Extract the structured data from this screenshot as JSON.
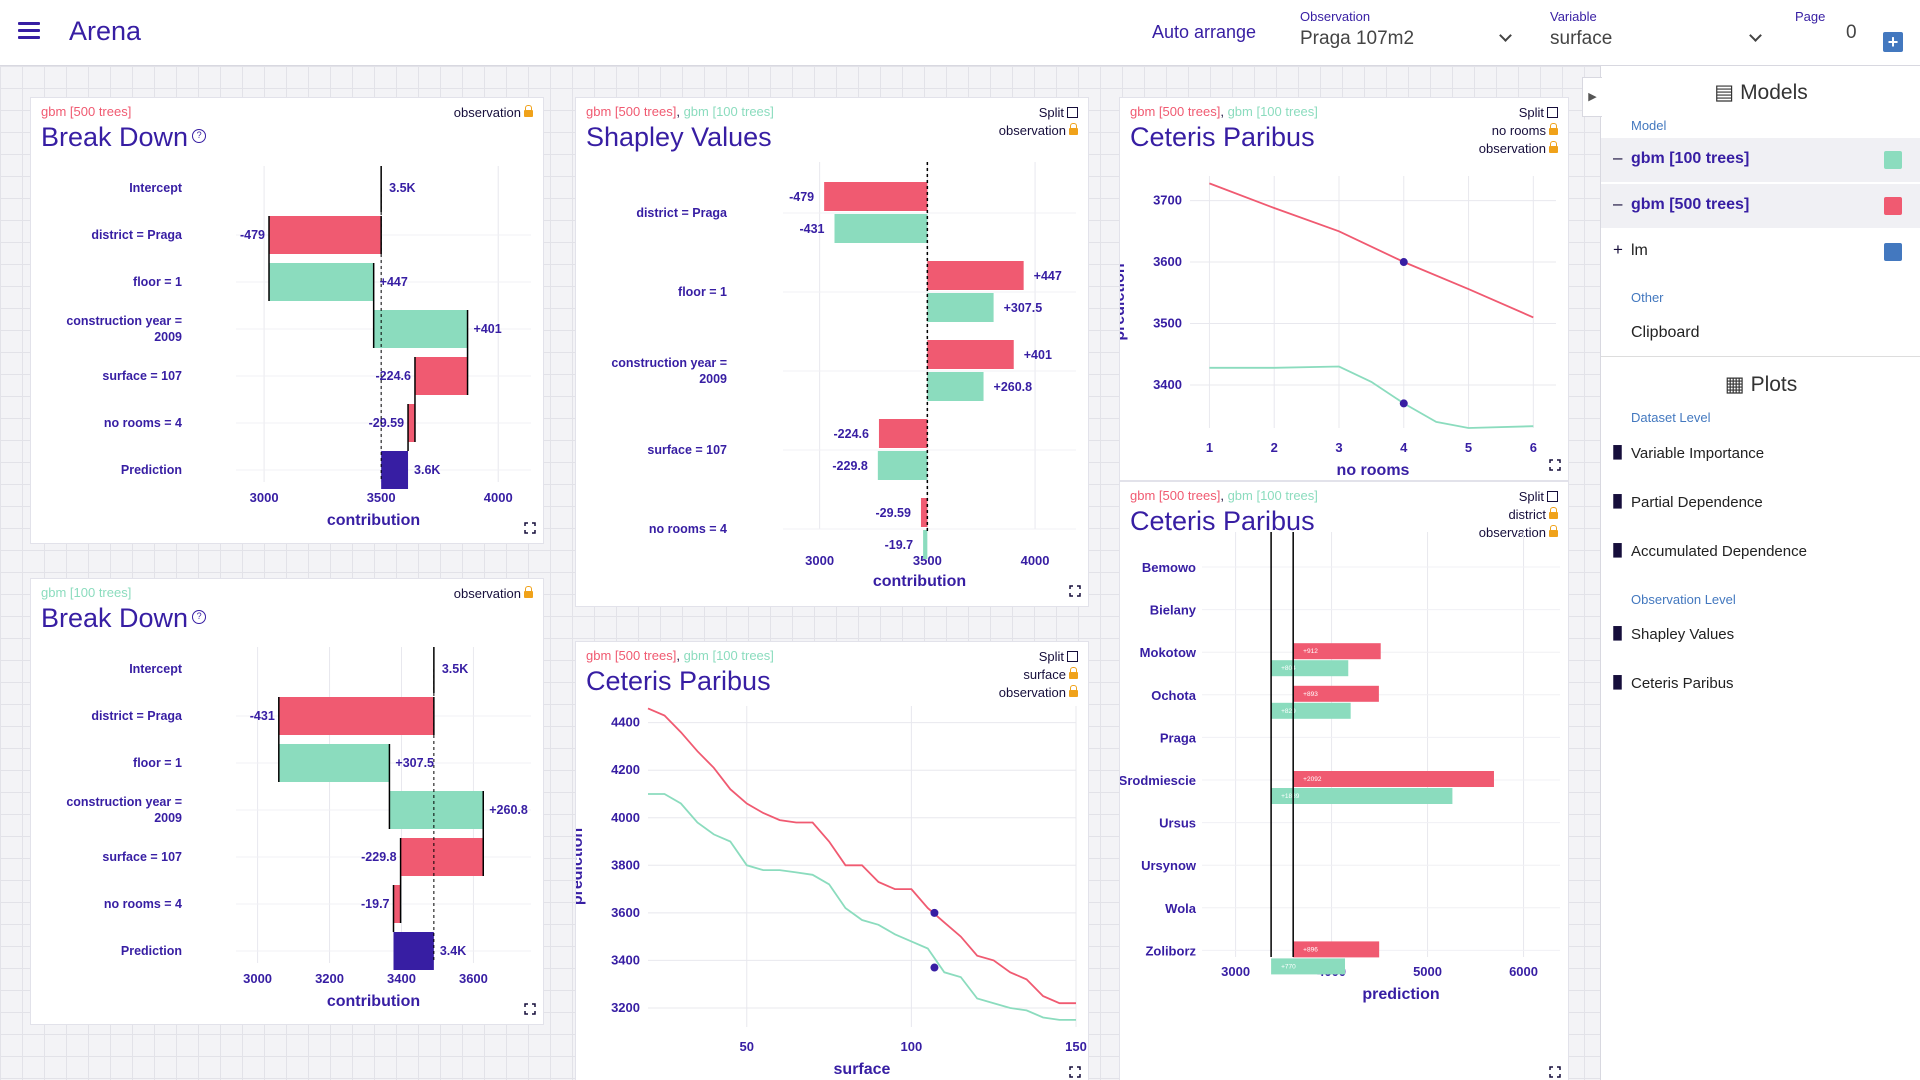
{
  "header": {
    "title": "Arena",
    "auto_arrange": "Auto arrange",
    "observation_label": "Observation",
    "observation_value": "Praga 107m2",
    "variable_label": "Variable",
    "variable_value": "surface",
    "page_label": "Page",
    "page_value": "0",
    "add_page": "+"
  },
  "colors": {
    "gbm500": "#f05a71",
    "gbm100": "#8bdcbe",
    "lm": "#4378bf",
    "accent": "#371ea3",
    "prediction": "#371ea3"
  },
  "panels": {
    "bd1": {
      "model": "gbm [500 trees]",
      "title": "Break Down",
      "right": [
        "observation"
      ]
    },
    "bd2": {
      "model": "gbm [100 trees]",
      "title": "Break Down",
      "right": [
        "observation"
      ]
    },
    "sv": {
      "model1": "gbm [500 trees]",
      "sep": ", ",
      "model2": "gbm [100 trees]",
      "title": "Shapley Values",
      "right": [
        "Split",
        "observation"
      ]
    },
    "cp1": {
      "model1": "gbm [500 trees]",
      "sep": ", ",
      "model2": "gbm [100 trees]",
      "title": "Ceteris Paribus",
      "right": [
        "Split",
        "no rooms",
        "observation"
      ]
    },
    "cp2": {
      "model1": "gbm [500 trees]",
      "sep": ", ",
      "model2": "gbm [100 trees]",
      "title": "Ceteris Paribus",
      "right": [
        "Split",
        "surface",
        "observation"
      ]
    },
    "cp3": {
      "model1": "gbm [500 trees]",
      "sep": ", ",
      "model2": "gbm [100 trees]",
      "title": "Ceteris Paribus",
      "right": [
        "Split",
        "district",
        "observation"
      ]
    }
  },
  "sidebar": {
    "models_title": "Models",
    "model_label": "Model",
    "models": [
      {
        "sign": "–",
        "name": "gbm [100 trees]",
        "color": "#8bdcbe",
        "active": true
      },
      {
        "sign": "–",
        "name": "gbm [500 trees]",
        "color": "#f05a71",
        "active": true
      },
      {
        "sign": "+",
        "name": "lm",
        "color": "#4378bf",
        "active": false
      }
    ],
    "other_label": "Other",
    "clipboard": "Clipboard",
    "plots_title": "Plots",
    "dataset_level": "Dataset Level",
    "dataset_plots": [
      "Variable Importance",
      "Partial Dependence",
      "Accumulated Dependence"
    ],
    "observation_level": "Observation Level",
    "observation_plots": [
      "Shapley Values",
      "Ceteris Paribus"
    ]
  },
  "chart_data": [
    {
      "id": "bd1",
      "type": "bar",
      "subtype": "waterfall",
      "model": "gbm [500 trees]",
      "title": "Break Down",
      "xlabel": "contribution",
      "xlim": [
        2880,
        4140
      ],
      "xticks": [
        3000,
        3500,
        4000
      ],
      "grid": true,
      "rows": [
        {
          "label": "Intercept",
          "start": 3500,
          "end": 3500,
          "text": "3.5K",
          "kind": "intercept"
        },
        {
          "label": "district = Praga",
          "start": 3500,
          "end": 3021,
          "text": "-479",
          "kind": "neg"
        },
        {
          "label": "floor = 1",
          "start": 3021,
          "end": 3468,
          "text": "+447",
          "kind": "pos"
        },
        {
          "label": "construction year = 2009",
          "start": 3468,
          "end": 3869,
          "text": "+401",
          "kind": "pos"
        },
        {
          "label": "surface = 107",
          "start": 3869,
          "end": 3644.4,
          "text": "-224.6",
          "kind": "neg"
        },
        {
          "label": "no rooms = 4",
          "start": 3644.4,
          "end": 3614.8,
          "text": "-29.59",
          "kind": "neg"
        },
        {
          "label": "Prediction",
          "start": 3500,
          "end": 3614.8,
          "text": "3.6K",
          "kind": "pred"
        }
      ]
    },
    {
      "id": "bd2",
      "type": "bar",
      "subtype": "waterfall",
      "model": "gbm [100 trees]",
      "title": "Break Down",
      "xlabel": "contribution",
      "xlim": [
        2940,
        3760
      ],
      "xticks": [
        3000,
        3200,
        3400,
        3600
      ],
      "grid": true,
      "rows": [
        {
          "label": "Intercept",
          "start": 3490,
          "end": 3490,
          "text": "3.5K",
          "kind": "intercept"
        },
        {
          "label": "district = Praga",
          "start": 3490,
          "end": 3059,
          "text": "-431",
          "kind": "neg"
        },
        {
          "label": "floor = 1",
          "start": 3059,
          "end": 3366.5,
          "text": "+307.5",
          "kind": "pos"
        },
        {
          "label": "construction year = 2009",
          "start": 3366.5,
          "end": 3627.3,
          "text": "+260.8",
          "kind": "pos"
        },
        {
          "label": "surface = 107",
          "start": 3627.3,
          "end": 3397.5,
          "text": "-229.8",
          "kind": "neg"
        },
        {
          "label": "no rooms = 4",
          "start": 3397.5,
          "end": 3377.8,
          "text": "-19.7",
          "kind": "neg"
        },
        {
          "label": "Prediction",
          "start": 3490,
          "end": 3377.8,
          "text": "3.4K",
          "kind": "pred"
        }
      ]
    },
    {
      "id": "sv",
      "type": "bar",
      "subtype": "shapley",
      "title": "Shapley Values",
      "xlabel": "contribution",
      "baseline": 3500,
      "xlim": [
        2830,
        4190
      ],
      "xticks": [
        3000,
        3500,
        4000
      ],
      "grid": true,
      "categories": [
        "district = Praga",
        "floor = 1",
        "construction year = 2009",
        "surface = 107",
        "no rooms = 4"
      ],
      "series": [
        {
          "name": "gbm [500 trees]",
          "values": [
            -479,
            447,
            401,
            -224.6,
            -29.59
          ],
          "texts": [
            "-479",
            "+447",
            "+401",
            "-224.6",
            "-29.59"
          ]
        },
        {
          "name": "gbm [100 trees]",
          "values": [
            -431,
            307.5,
            260.8,
            -229.8,
            -19.7
          ],
          "texts": [
            "-431",
            "+307.5",
            "+260.8",
            "-229.8",
            "-19.7"
          ]
        }
      ]
    },
    {
      "id": "cp1",
      "type": "line",
      "title": "Ceteris Paribus",
      "xlabel": "no rooms",
      "ylabel": "prediction",
      "xlim": [
        0.7,
        6.35
      ],
      "ylim": [
        3330,
        3740
      ],
      "xticks": [
        1,
        2,
        3,
        4,
        5,
        6
      ],
      "yticks": [
        3400,
        3500,
        3600,
        3700
      ],
      "grid": true,
      "series": [
        {
          "name": "gbm [500 trees]",
          "x": [
            1,
            2,
            3,
            4,
            5,
            6
          ],
          "y": [
            3728,
            3688,
            3650,
            3600,
            3556,
            3510
          ],
          "observed": {
            "x": 4,
            "y": 3600
          }
        },
        {
          "name": "gbm [100 trees]",
          "x": [
            1,
            2,
            3,
            3.5,
            4,
            4.5,
            5,
            6
          ],
          "y": [
            3428,
            3428,
            3430,
            3405,
            3370,
            3340,
            3330,
            3333
          ],
          "observed": {
            "x": 4,
            "y": 3370
          }
        }
      ]
    },
    {
      "id": "cp2",
      "type": "line",
      "title": "Ceteris Paribus",
      "xlabel": "surface",
      "ylabel": "prediction",
      "xlim": [
        20,
        150
      ],
      "ylim": [
        3120,
        4470
      ],
      "xticks": [
        50,
        100,
        150
      ],
      "yticks": [
        3200,
        3400,
        3600,
        3800,
        4000,
        4200,
        4400
      ],
      "grid": true,
      "series": [
        {
          "name": "gbm [500 trees]",
          "x": [
            20,
            25,
            30,
            35,
            40,
            45,
            50,
            55,
            60,
            65,
            70,
            75,
            80,
            85,
            90,
            95,
            100,
            105,
            110,
            115,
            120,
            125,
            130,
            135,
            140,
            145,
            150
          ],
          "y": [
            4460,
            4430,
            4360,
            4280,
            4210,
            4120,
            4060,
            4020,
            3990,
            3980,
            3980,
            3900,
            3800,
            3800,
            3730,
            3700,
            3700,
            3620,
            3560,
            3500,
            3420,
            3400,
            3350,
            3320,
            3250,
            3220,
            3220
          ],
          "observed": {
            "x": 107,
            "y": 3600
          }
        },
        {
          "name": "gbm [100 trees]",
          "x": [
            20,
            25,
            30,
            35,
            40,
            45,
            50,
            55,
            60,
            65,
            70,
            75,
            80,
            85,
            90,
            95,
            100,
            105,
            110,
            115,
            120,
            125,
            130,
            135,
            140,
            145,
            150
          ],
          "y": [
            4100,
            4100,
            4060,
            3980,
            3930,
            3900,
            3800,
            3780,
            3780,
            3770,
            3760,
            3720,
            3620,
            3570,
            3550,
            3510,
            3480,
            3450,
            3350,
            3330,
            3240,
            3220,
            3200,
            3190,
            3160,
            3150,
            3150
          ],
          "observed": {
            "x": 107,
            "y": 3370
          }
        }
      ]
    },
    {
      "id": "cp3",
      "type": "bar",
      "subtype": "categorical-ceteris-paribus",
      "title": "Ceteris Paribus",
      "xlabel": "prediction",
      "xlim": [
        2650,
        6380
      ],
      "xticks": [
        3000,
        4000,
        5000,
        6000
      ],
      "grid": true,
      "categories": [
        "Bemowo",
        "Bielany",
        "Mokotow",
        "Ochota",
        "Praga",
        "Srodmiescie",
        "Ursus",
        "Ursynow",
        "Wola",
        "Zoliborz"
      ],
      "series": [
        {
          "name": "gbm [500 trees]",
          "baseline": 3600,
          "values": [
            0,
            0,
            912,
            893,
            0,
            2092,
            0,
            0,
            0,
            896
          ],
          "texts": [
            "",
            "",
            "+912",
            "+893",
            "",
            "+2092",
            "",
            "",
            "",
            "+896"
          ]
        },
        {
          "name": "gbm [100 trees]",
          "baseline": 3370,
          "values": [
            0,
            0,
            804,
            829,
            0,
            1889,
            0,
            0,
            0,
            770
          ],
          "texts": [
            "",
            "",
            "+804",
            "+829",
            "",
            "+1889",
            "",
            "",
            "",
            "+770"
          ]
        }
      ]
    }
  ]
}
